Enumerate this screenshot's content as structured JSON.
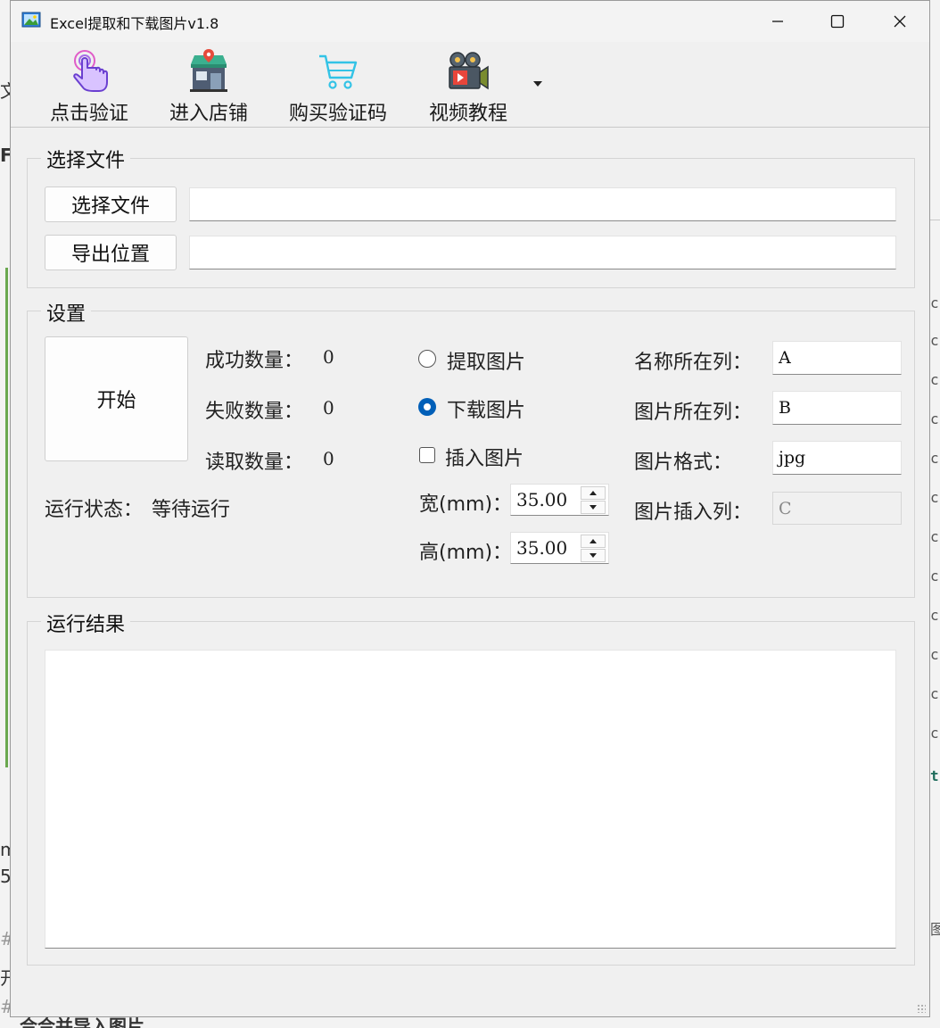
{
  "window": {
    "title": "Excel提取和下载图片v1.8",
    "controls": {
      "minimize": "—",
      "maximize": "☐",
      "close": "✕"
    }
  },
  "toolbar": {
    "items": [
      {
        "label": "点击验证",
        "icon": "pointer-hand-icon"
      },
      {
        "label": "进入店铺",
        "icon": "shop-icon"
      },
      {
        "label": "购买验证码",
        "icon": "shopping-cart-icon"
      },
      {
        "label": "视频教程",
        "icon": "video-camera-icon"
      }
    ],
    "more_icon": "dropdown-arrow-icon"
  },
  "file_group": {
    "title": "选择文件",
    "select_button": "选择文件",
    "select_path": "",
    "export_button": "导出位置",
    "export_path": ""
  },
  "settings": {
    "title": "设置",
    "start_button": "开始",
    "success_label": "成功数量：",
    "success_value": "0",
    "fail_label": "失败数量：",
    "fail_value": "0",
    "read_label": "读取数量：",
    "read_value": "0",
    "status_label": "运行状态：",
    "status_value": "等待运行",
    "mode_extract": "提取图片",
    "mode_download": "下载图片",
    "mode_selected": "下载图片",
    "insert_label": "插入图片",
    "insert_checked": false,
    "width_label": "宽(mm)：",
    "width_value": "35.00",
    "height_label": "高(mm)：",
    "height_value": "35.00",
    "name_col_label": "名称所在列：",
    "name_col_value": "A",
    "image_col_label": "图片所在列：",
    "image_col_value": "B",
    "format_label": "图片格式：",
    "format_value": "jpg",
    "insert_col_label": "图片插入列：",
    "insert_col_value": "C"
  },
  "results": {
    "title": "运行结果",
    "content": ""
  },
  "background": {
    "left_fragments": [
      "文",
      "F",
      "m",
      "5",
      "#",
      "开",
      "#"
    ],
    "right_fragments": [
      "c.",
      "c.",
      "c.",
      "c.",
      "c.",
      "c.",
      "c.",
      "c.",
      "c.",
      "c.",
      "c.",
      "c.",
      "t'",
      "图"
    ],
    "bottom_fragment": "合合并导入图片"
  },
  "colors": {
    "window_bg": "#f0f0f0",
    "accent": "#005fb8",
    "border": "#d5d5d5"
  }
}
